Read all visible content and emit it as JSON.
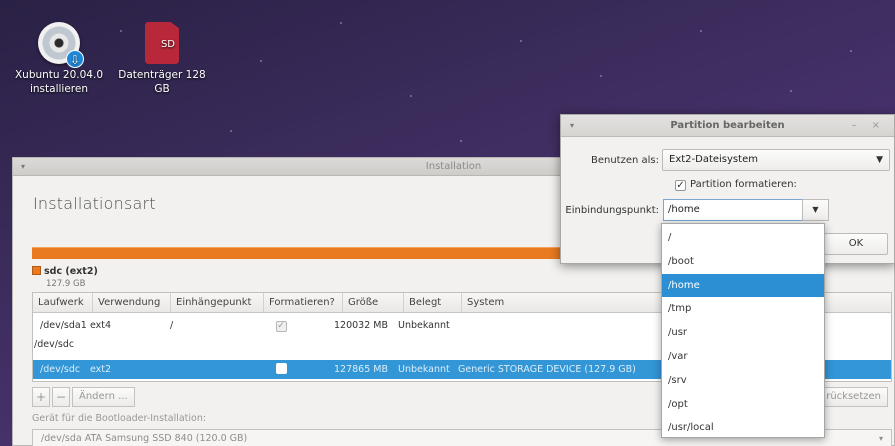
{
  "desktop": {
    "icons": [
      {
        "label": "Xubuntu 20.04.0 installieren",
        "icon": "cd-install-icon"
      },
      {
        "label": "Datenträger 128 GB",
        "icon": "sd-card-icon",
        "badge_text": "SD"
      }
    ]
  },
  "installer": {
    "window_title": "Installation",
    "page_title": "Installationsart",
    "partition_legend": {
      "name": "sdc (ext2)",
      "size": "127.9 GB"
    },
    "table": {
      "headers": [
        "Laufwerk",
        "Verwendung",
        "Einhängepunkt",
        "Formatieren?",
        "Größe",
        "Belegt",
        "System"
      ],
      "rows": [
        {
          "device": "/dev/sda1",
          "type": "ext4",
          "mount": "/",
          "format": true,
          "size": "120032 MB",
          "used": "Unbekannt",
          "system": ""
        },
        {
          "device": "/dev/sdc",
          "type": "",
          "mount": "",
          "format": null,
          "size": "",
          "used": "",
          "system": ""
        },
        {
          "device": "/dev/sdc",
          "type": "ext2",
          "mount": "",
          "format": false,
          "size": "127865 MB",
          "used": "Unbekannt",
          "system": "Generic STORAGE DEVICE (127.9 GB)"
        }
      ]
    },
    "buttons": {
      "add": "+",
      "remove": "−",
      "change": "Ändern ...",
      "reset": "rücksetzen"
    },
    "bootloader_label": "Gerät für die Bootloader-Installation:",
    "bootloader_value": "/dev/sda   ATA Samsung SSD 840 (120.0 GB)"
  },
  "dialog": {
    "title": "Partition bearbeiten",
    "use_as_label": "Benutzen als:",
    "use_as_value": "Ext2-Dateisystem",
    "format_label": "Partition formatieren:",
    "format_checked": true,
    "mount_label": "Einbindungspunkt:",
    "mount_value": "/home",
    "ok_label": "OK",
    "window_controls": "– ×"
  },
  "mount_options": [
    "/",
    "/boot",
    "/home",
    "/tmp",
    "/usr",
    "/var",
    "/srv",
    "/opt",
    "/usr/local"
  ],
  "mount_selected_index": 2,
  "colors": {
    "accent": "#2d8fd3",
    "partition": "#ea7a21"
  }
}
